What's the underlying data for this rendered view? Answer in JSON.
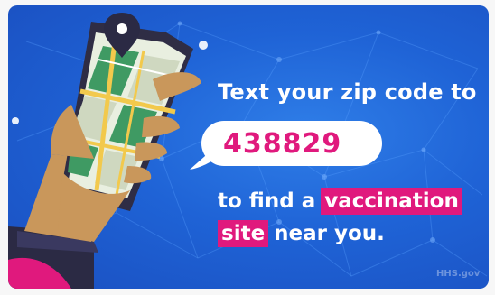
{
  "banner": {
    "headline": "Text your zip code to",
    "code": "438829",
    "line2_prefix": "to find a",
    "line2_highlight": "vaccination",
    "line3_highlight": "site",
    "line3_suffix": "near you.",
    "watermark": "HHS.gov"
  },
  "colors": {
    "background_blue": "#1f63d6",
    "accent_pink": "#e0197d",
    "text_white": "#ffffff",
    "phone_dark": "#2f2d45",
    "map_green": "#2e8b57",
    "map_yellow": "#f2c94c"
  },
  "icons": [
    "location-pin-icon",
    "map-icon",
    "hand-icon",
    "phone-icon"
  ]
}
